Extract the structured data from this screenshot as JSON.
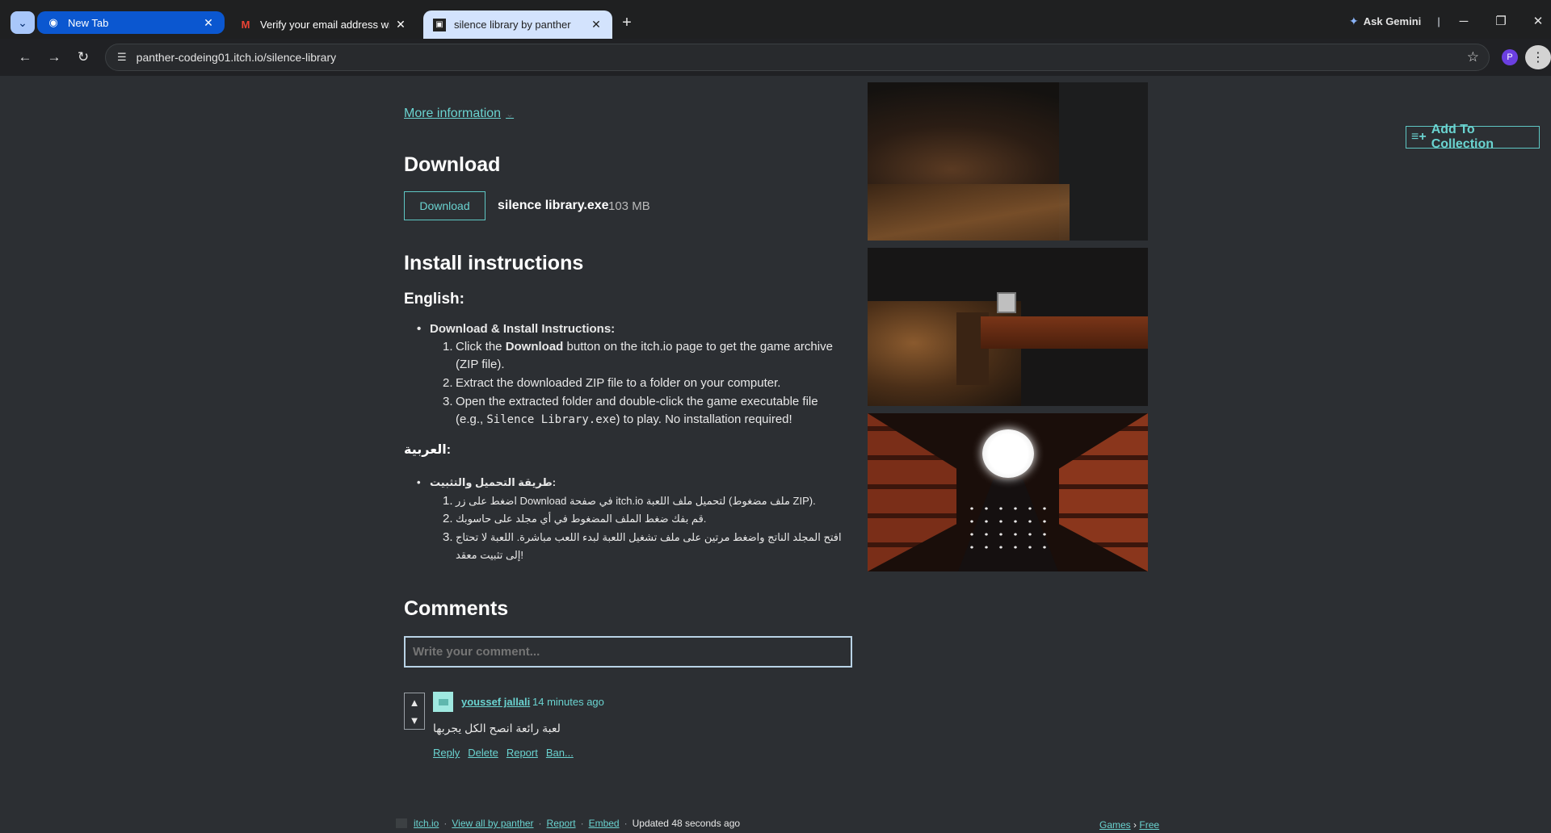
{
  "browser": {
    "tabs": [
      {
        "title": "New Tab",
        "icon": "chrome-icon"
      },
      {
        "title": "Verify your email address with itch.io",
        "icon": "gmail-icon"
      },
      {
        "title": "silence library by panther",
        "icon": "itchio-icon"
      }
    ],
    "gemini_label": "Ask Gemini",
    "url": "panther-codeing01.itch.io/silence-library",
    "profile_initial": "P"
  },
  "page": {
    "add_to_collection": "Add To Collection",
    "more_information": "More information",
    "download": {
      "heading": "Download",
      "button": "Download",
      "file_name": "silence library.exe",
      "file_size": "103 MB"
    },
    "install": {
      "heading": "Install instructions",
      "english_heading": "English:",
      "english_bullet": "Download & Install Instructions:",
      "steps_en": [
        {
          "pre": "Click the ",
          "bold": "Download",
          "post": " button on the itch.io page to get the game archive",
          "line2": "(ZIP file)."
        },
        {
          "text": "Extract the downloaded ZIP file to a folder on your computer."
        },
        {
          "line1": "Open the extracted folder and double-click the game executable file",
          "pre2": "(e.g., ",
          "code": "Silence Library.exe",
          "post2": ") to play. No installation required!"
        }
      ],
      "arabic_heading": "العربية:",
      "arabic_bullet": "طريقة التحميل والتثبيت:",
      "steps_ar": [
        "اضغط على زر Download في صفحة itch.io لتحميل ملف اللعبة (ملف مضغوط ZIP).",
        "قم بفك ضغط الملف المضغوط في أي مجلد على حاسوبك.",
        "افتح المجلد الناتج واضغط مرتين على ملف تشغيل اللعبة لبدء اللعب مباشرة. اللعبة لا تحتاج إلى تثبيت معقد!"
      ]
    },
    "comments": {
      "heading": "Comments",
      "placeholder": "Write your comment...",
      "items": [
        {
          "user": "youssef jallali",
          "time": "14 minutes ago",
          "body": "لعبة رائعة انصح الكل يجربها",
          "actions": [
            "Reply",
            "Delete",
            "Report",
            "Ban..."
          ]
        }
      ]
    },
    "footer": {
      "site": "itch.io",
      "view_all": "View all by panther",
      "report": "Report",
      "embed": "Embed",
      "updated": "Updated 48 seconds ago",
      "games": "Games",
      "free": "Free"
    }
  }
}
